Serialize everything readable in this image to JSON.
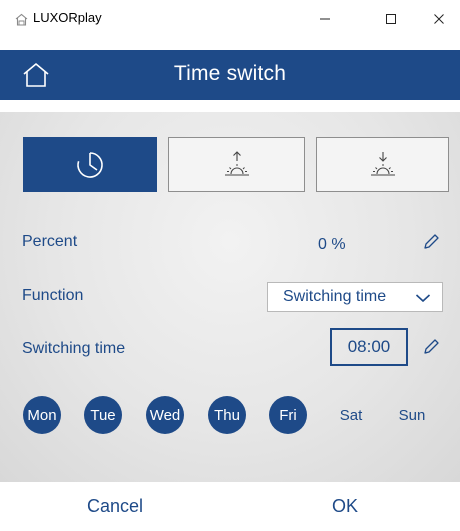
{
  "window": {
    "title": "LUXORplay"
  },
  "header": {
    "title": "Time switch"
  },
  "icons": {
    "app": "house-icon",
    "home": "home-icon",
    "clock": "clock-icon",
    "sunrise": "sunrise-icon",
    "sunset": "sunset-icon",
    "edit": "pencil-icon",
    "dropdown": "chevron-down-icon"
  },
  "modes": [
    {
      "name": "clock",
      "selected": true
    },
    {
      "name": "sunrise",
      "selected": false
    },
    {
      "name": "sunset",
      "selected": false
    }
  ],
  "fields": {
    "percent_label": "Percent",
    "percent_value": "0 %",
    "function_label": "Function",
    "function_value": "Switching time",
    "switching_label": "Switching time",
    "switching_value": "08:00"
  },
  "days": [
    {
      "label": "Mon",
      "active": true
    },
    {
      "label": "Tue",
      "active": true
    },
    {
      "label": "Wed",
      "active": true
    },
    {
      "label": "Thu",
      "active": true
    },
    {
      "label": "Fri",
      "active": true
    },
    {
      "label": "Sat",
      "active": false
    },
    {
      "label": "Sun",
      "active": false
    }
  ],
  "footer": {
    "cancel_label": "Cancel",
    "ok_label": "OK"
  },
  "colors": {
    "accent": "#1e4a88",
    "background": "#e6e6e6"
  }
}
